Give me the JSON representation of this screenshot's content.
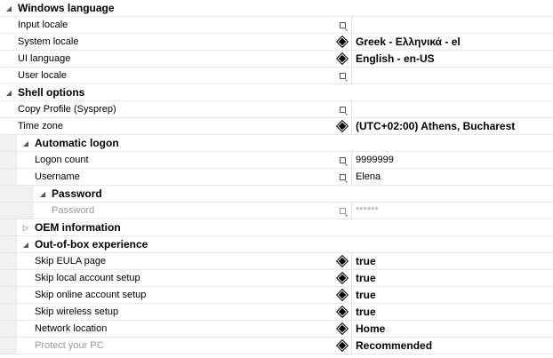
{
  "rows": [
    {
      "type": "category",
      "depth": 0,
      "expander": "expanded",
      "label": "Windows language"
    },
    {
      "type": "prop",
      "depth": 0,
      "label": "Input locale",
      "icon": "empty",
      "value": "",
      "valueStyle": "normal"
    },
    {
      "type": "prop",
      "depth": 0,
      "label": "System locale",
      "icon": "diamond",
      "value": "Greek - Ελληνικά - el",
      "valueStyle": "bold"
    },
    {
      "type": "prop",
      "depth": 0,
      "label": "UI language",
      "icon": "diamond",
      "value": "English - en-US",
      "valueStyle": "bold"
    },
    {
      "type": "prop",
      "depth": 0,
      "label": "User locale",
      "icon": "empty",
      "value": "",
      "valueStyle": "normal"
    },
    {
      "type": "category",
      "depth": 0,
      "expander": "expanded",
      "label": "Shell options"
    },
    {
      "type": "prop",
      "depth": 0,
      "label": "Copy Profile (Sysprep)",
      "icon": "empty",
      "value": "",
      "valueStyle": "normal"
    },
    {
      "type": "prop",
      "depth": 0,
      "label": "Time zone",
      "icon": "diamond",
      "value": "(UTC+02:00) Athens, Bucharest",
      "valueStyle": "bold"
    },
    {
      "type": "category",
      "depth": 1,
      "expander": "expanded",
      "label": "Automatic logon"
    },
    {
      "type": "prop",
      "depth": 1,
      "label": "Logon count",
      "icon": "empty",
      "value": "9999999",
      "valueStyle": "normal"
    },
    {
      "type": "prop",
      "depth": 1,
      "label": "Username",
      "icon": "empty",
      "value": "Elena",
      "valueStyle": "normal"
    },
    {
      "type": "category",
      "depth": 2,
      "expander": "expanded",
      "label": "Password"
    },
    {
      "type": "prop",
      "depth": 2,
      "label": "Password",
      "icon": "empty-gray",
      "value": "******",
      "valueStyle": "gray",
      "disabled": true
    },
    {
      "type": "category",
      "depth": 1,
      "expander": "collapsed",
      "label": "OEM information"
    },
    {
      "type": "category",
      "depth": 1,
      "expander": "expanded",
      "label": "Out-of-box experience"
    },
    {
      "type": "prop",
      "depth": 1,
      "label": "Skip EULA page",
      "icon": "diamond",
      "value": "true",
      "valueStyle": "bold"
    },
    {
      "type": "prop",
      "depth": 1,
      "label": "Skip local account setup",
      "icon": "diamond",
      "value": "true",
      "valueStyle": "bold"
    },
    {
      "type": "prop",
      "depth": 1,
      "label": "Skip online account setup",
      "icon": "diamond",
      "value": "true",
      "valueStyle": "bold"
    },
    {
      "type": "prop",
      "depth": 1,
      "label": "Skip wireless setup",
      "icon": "diamond",
      "value": "true",
      "valueStyle": "bold"
    },
    {
      "type": "prop",
      "depth": 1,
      "label": "Network location",
      "icon": "diamond",
      "value": "Home",
      "valueStyle": "bold"
    },
    {
      "type": "prop",
      "depth": 1,
      "label": "Protect your PC",
      "icon": "diamond",
      "value": "Recommended",
      "valueStyle": "bold",
      "disabled": true
    }
  ],
  "icons": {
    "expanded": "expand-arrow-icon",
    "collapsed": "collapse-arrow-icon",
    "diamond": "value-set-icon",
    "empty": "value-unset-icon"
  }
}
